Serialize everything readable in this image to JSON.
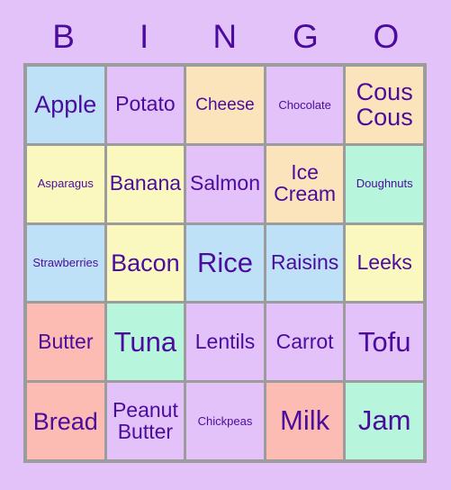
{
  "card": {
    "title": "BINGO",
    "columns": [
      "B",
      "I",
      "N",
      "G",
      "O"
    ],
    "colors": {
      "background": "#e2c2f9",
      "grid_border": "#9c9c9c",
      "text": "#4b0c9e",
      "blue": "#bfe1f8",
      "lavender": "#e2c2f9",
      "peach": "#fbe3bb",
      "yellow": "#fbf8bf",
      "mint": "#b8f5dd",
      "pink": "#fcbcb4"
    },
    "rows": [
      [
        {
          "label": "Apple",
          "color": "blue",
          "size": "lg"
        },
        {
          "label": "Potato",
          "color": "lavender",
          "size": "md"
        },
        {
          "label": "Cheese",
          "color": "peach",
          "size": "sm"
        },
        {
          "label": "Chocolate",
          "color": "lavender",
          "size": "xs"
        },
        {
          "label": "Cous\nCous",
          "color": "peach",
          "size": "lg"
        }
      ],
      [
        {
          "label": "Asparagus",
          "color": "yellow",
          "size": "xs"
        },
        {
          "label": "Banana",
          "color": "yellow",
          "size": "md"
        },
        {
          "label": "Salmon",
          "color": "lavender",
          "size": "md"
        },
        {
          "label": "Ice\nCream",
          "color": "peach",
          "size": "md"
        },
        {
          "label": "Doughnuts",
          "color": "mint",
          "size": "xs"
        }
      ],
      [
        {
          "label": "Strawberries",
          "color": "blue",
          "size": "xs"
        },
        {
          "label": "Bacon",
          "color": "yellow",
          "size": "lg"
        },
        {
          "label": "Rice",
          "color": "blue",
          "size": "xl"
        },
        {
          "label": "Raisins",
          "color": "blue",
          "size": "md"
        },
        {
          "label": "Leeks",
          "color": "yellow",
          "size": "md"
        }
      ],
      [
        {
          "label": "Butter",
          "color": "pink",
          "size": "md"
        },
        {
          "label": "Tuna",
          "color": "mint",
          "size": "xl"
        },
        {
          "label": "Lentils",
          "color": "lavender",
          "size": "md"
        },
        {
          "label": "Carrot",
          "color": "lavender",
          "size": "md"
        },
        {
          "label": "Tofu",
          "color": "lavender",
          "size": "xl"
        }
      ],
      [
        {
          "label": "Bread",
          "color": "pink",
          "size": "lg"
        },
        {
          "label": "Peanut\nButter",
          "color": "lavender",
          "size": "md"
        },
        {
          "label": "Chickpeas",
          "color": "lavender",
          "size": "xs"
        },
        {
          "label": "Milk",
          "color": "pink",
          "size": "xl"
        },
        {
          "label": "Jam",
          "color": "mint",
          "size": "xl"
        }
      ]
    ]
  }
}
